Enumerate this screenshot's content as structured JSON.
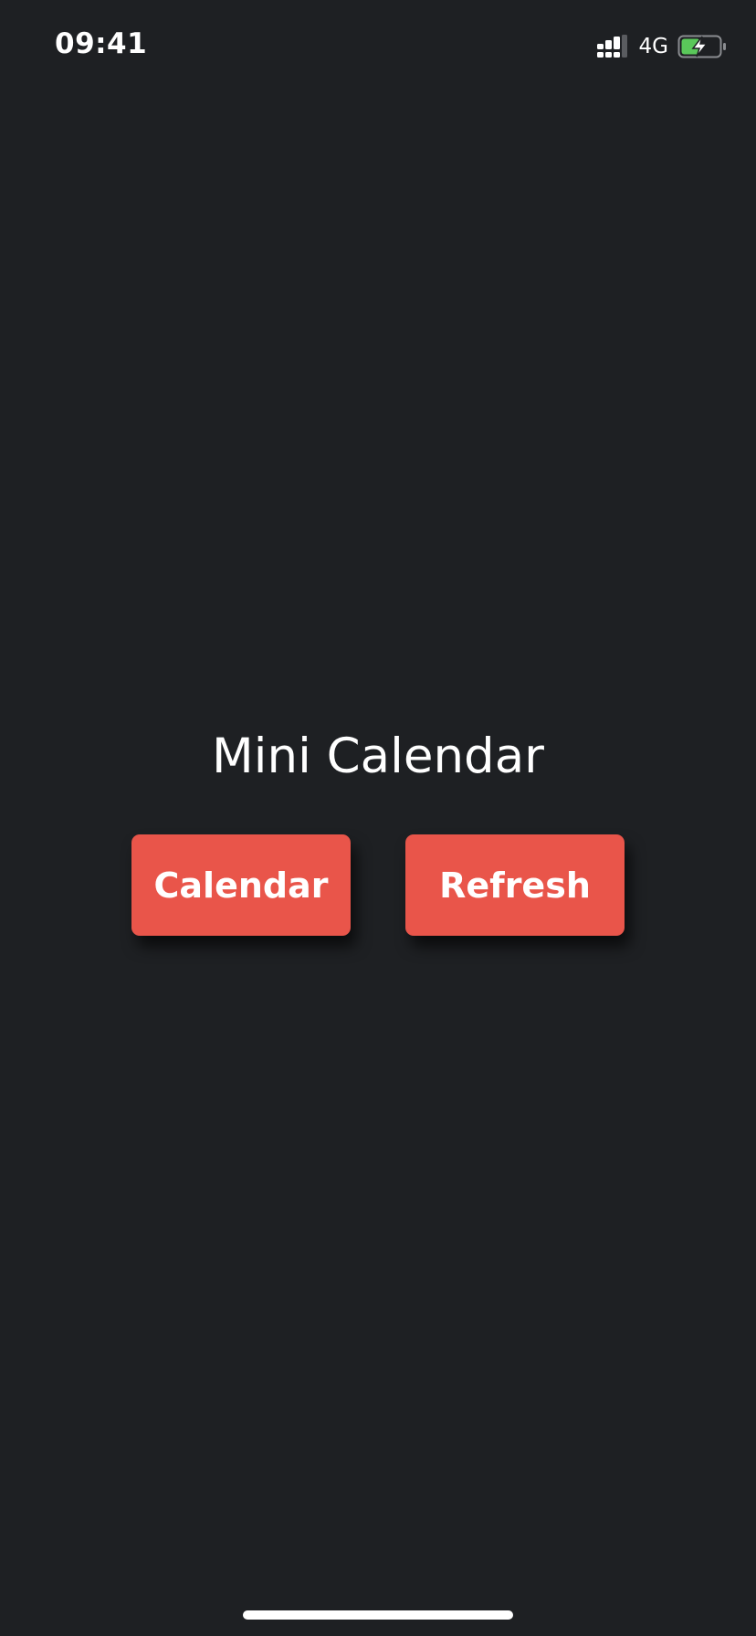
{
  "status_bar": {
    "time": "09:41",
    "network": "4G",
    "icons": [
      "signal-icon",
      "battery-charging-icon"
    ],
    "battery_fill_color": "#5ac85a"
  },
  "main": {
    "title": "Mini Calendar",
    "buttons": [
      {
        "label": "Calendar"
      },
      {
        "label": "Refresh"
      }
    ],
    "button_color": "#e9554a",
    "background_color": "#1e2023"
  }
}
